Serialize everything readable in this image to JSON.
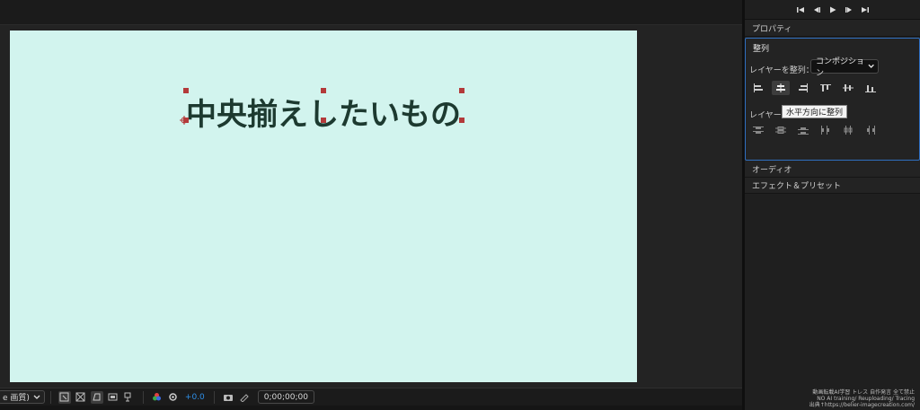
{
  "canvas": {
    "text": "中央揃えしたいもの",
    "background_color": "#d2f4ee",
    "text_color": "#1d3a30"
  },
  "viewer_toolbar": {
    "quality": "e 画質)",
    "exposure": "+0.0",
    "timecode": "0;00;00;00"
  },
  "right_panel": {
    "properties_label": "プロパティ",
    "align": {
      "title": "整列",
      "align_layers_label": "レイヤーを整列：",
      "align_to_value": "コンポジション",
      "distribute_label": "レイヤーを配",
      "tooltip": "水平方向に整列"
    },
    "audio_label": "オーディオ",
    "effects_label": "エフェクト＆プリセット"
  },
  "watermark": {
    "line1": "動画転載AI学習 トレス 自作発言 全て禁止",
    "line2": "NO AI training/ Reuploading/ Tracing",
    "line3": "出典↑https://belier-imagecreation.com/"
  },
  "colors": {
    "accent_blue": "#2f6fc0",
    "handle_red": "#b33a3a"
  }
}
